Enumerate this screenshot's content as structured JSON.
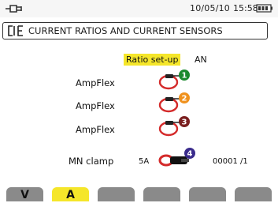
{
  "status": {
    "date": "10/05/10",
    "time": "15:58",
    "icons": [
      "plug-icon",
      "battery-icon"
    ]
  },
  "title": {
    "text": "CURRENT RATIOS AND CURRENT SENSORS",
    "icon": "current-ratio-icon"
  },
  "ratio_setup": {
    "label": "Ratio set-up",
    "value": "AN"
  },
  "sensors": [
    {
      "label": "AmpFlex",
      "number": "1",
      "color": "#1c8a2e"
    },
    {
      "label": "AmpFlex",
      "number": "2",
      "color": "#f0921e"
    },
    {
      "label": "AmpFlex",
      "number": "3",
      "color": "#7a1f1f"
    }
  ],
  "mn_clamp": {
    "label": "MN clamp",
    "rating": "5A",
    "number": "4",
    "number_color": "#3b2c8c",
    "ratio": "00001 /1"
  },
  "tabs": [
    {
      "label": "V",
      "active": false
    },
    {
      "label": "A",
      "active": true
    },
    {
      "label": "",
      "active": false
    },
    {
      "label": "",
      "active": false
    },
    {
      "label": "",
      "active": false
    },
    {
      "label": "",
      "active": false
    }
  ],
  "colors": {
    "accent": "#f5e62a",
    "sensor_red": "#d42a2a",
    "tab_gray": "#8a8a8a"
  }
}
